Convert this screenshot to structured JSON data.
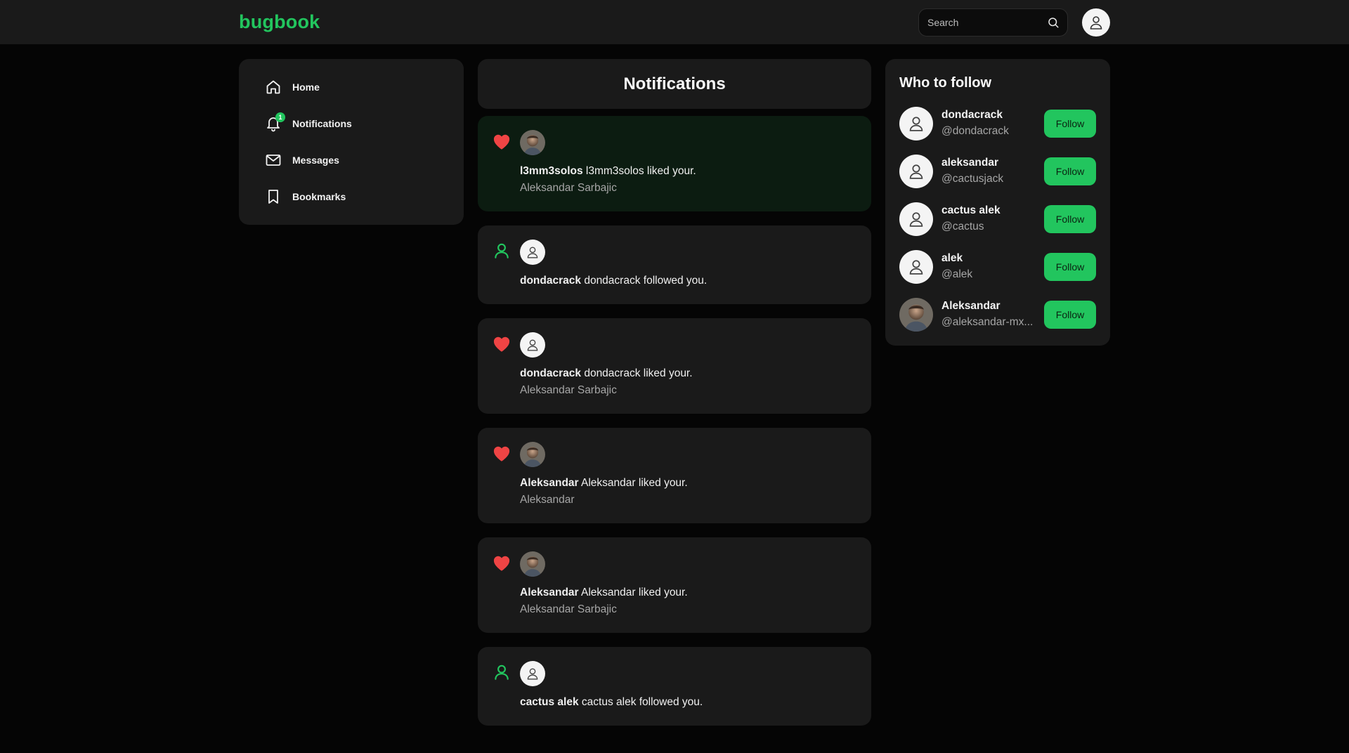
{
  "header": {
    "logo": "bugbook",
    "search_placeholder": "Search"
  },
  "nav": {
    "items": [
      {
        "label": "Home",
        "icon": "home-icon"
      },
      {
        "label": "Notifications",
        "icon": "bell-icon",
        "badge": "1"
      },
      {
        "label": "Messages",
        "icon": "mail-icon"
      },
      {
        "label": "Bookmarks",
        "icon": "bookmark-icon"
      }
    ]
  },
  "feed": {
    "title": "Notifications",
    "notifications": [
      {
        "type": "like",
        "unread": true,
        "avatar": "photo",
        "user": "l3mm3solos",
        "text": "l3mm3solos liked your.",
        "sub": "Aleksandar Sarbajic"
      },
      {
        "type": "follow",
        "unread": false,
        "avatar": "default",
        "user": "dondacrack",
        "text": "dondacrack followed you.",
        "sub": ""
      },
      {
        "type": "like",
        "unread": false,
        "avatar": "default",
        "user": "dondacrack",
        "text": "dondacrack liked your.",
        "sub": "Aleksandar Sarbajic"
      },
      {
        "type": "like",
        "unread": false,
        "avatar": "photo",
        "user": "Aleksandar",
        "text": "Aleksandar liked your.",
        "sub": "Aleksandar"
      },
      {
        "type": "like",
        "unread": false,
        "avatar": "photo",
        "user": "Aleksandar",
        "text": "Aleksandar liked your.",
        "sub": "Aleksandar Sarbajic"
      },
      {
        "type": "follow",
        "unread": false,
        "avatar": "default",
        "user": "cactus alek",
        "text": "cactus alek followed you.",
        "sub": ""
      }
    ]
  },
  "who_to_follow": {
    "title": "Who to follow",
    "button_label": "Follow",
    "users": [
      {
        "name": "dondacrack",
        "handle": "@dondacrack",
        "avatar": "default"
      },
      {
        "name": "aleksandar",
        "handle": "@cactusjack",
        "avatar": "default"
      },
      {
        "name": "cactus alek",
        "handle": "@cactus",
        "avatar": "default"
      },
      {
        "name": "alek",
        "handle": "@alek",
        "avatar": "default"
      },
      {
        "name": "Aleksandar",
        "handle": "@aleksandar-mx...",
        "avatar": "photo"
      }
    ]
  },
  "colors": {
    "accent": "#22c55e",
    "like": "#ef4444",
    "panel": "#1a1a1a",
    "unread_panel": "#0c1c11",
    "background": "#050505"
  }
}
